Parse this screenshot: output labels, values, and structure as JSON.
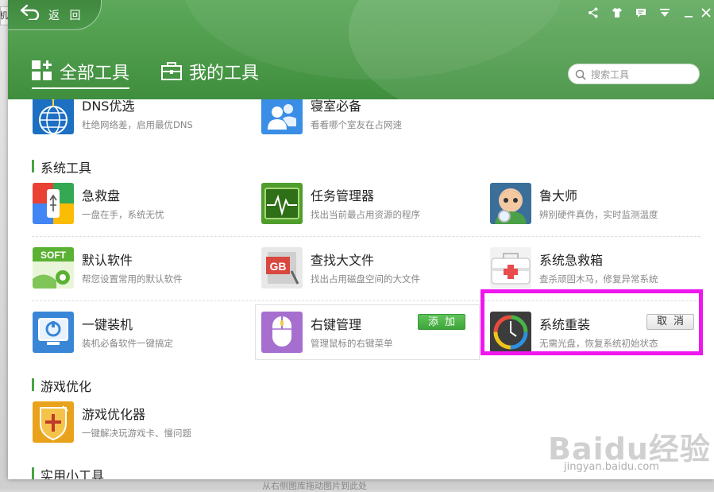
{
  "background": {
    "tab_fragment": "机",
    "hint_text": "从右侧图库拖动图片到此处"
  },
  "header": {
    "back_label": "返 回",
    "tabs": [
      {
        "label": "全部工具",
        "active": true
      },
      {
        "label": "我的工具",
        "active": false
      }
    ],
    "search_placeholder": "搜索工具",
    "window_controls": [
      "share-icon",
      "shirt-icon",
      "message-icon",
      "dropdown-icon",
      "minimize-icon",
      "close-icon"
    ],
    "accent_color": "#4f9d4d"
  },
  "sections": {
    "top_tools": [
      {
        "name": "DNS优选",
        "desc": "杜绝网络差，启用最优DNS",
        "icon": "globe-network-icon"
      },
      {
        "name": "寝室必备",
        "desc": "看看哪个室友在占网速",
        "icon": "roommates-icon"
      }
    ],
    "system": {
      "title": "系统工具",
      "tools": [
        {
          "name": "急救盘",
          "desc": "一盘在手，系统无忧",
          "icon": "usb-rescue-icon"
        },
        {
          "name": "任务管理器",
          "desc": "找出当前最占用资源的程序",
          "icon": "task-monitor-icon"
        },
        {
          "name": "鲁大师",
          "desc": "辨别硬件真伪，实时监测温度",
          "icon": "ludashi-icon"
        },
        {
          "name": "默认软件",
          "desc": "帮您设置常用的默认软件",
          "icon": "default-software-icon",
          "badge": "SOFT"
        },
        {
          "name": "查找大文件",
          "desc": "找出占用磁盘空间的大文件",
          "icon": "large-file-icon",
          "badge": "GB"
        },
        {
          "name": "系统急救箱",
          "desc": "查杀顽固木马，修复异常系统",
          "icon": "first-aid-kit-icon"
        },
        {
          "name": "一键装机",
          "desc": "装机必备软件一键搞定",
          "icon": "one-click-install-icon"
        },
        {
          "name": "右键管理",
          "desc": "管理鼠标的右键菜单",
          "icon": "mouse-right-click-icon",
          "button": "添加"
        },
        {
          "name": "系统重装",
          "desc": "无需光盘，恢复系统初始状态",
          "icon": "system-reinstall-icon",
          "button": "取消"
        }
      ]
    },
    "games": {
      "title": "游戏优化",
      "tools": [
        {
          "name": "游戏优化器",
          "desc": "一键解决玩游戏卡、慢问题",
          "icon": "game-booster-icon"
        }
      ]
    },
    "utilities": {
      "title": "实用小工具"
    }
  },
  "highlight_color": "#ee17ee",
  "watermark": {
    "logo_text": "Baidu经验",
    "url": "jingyan.baidu.com"
  }
}
